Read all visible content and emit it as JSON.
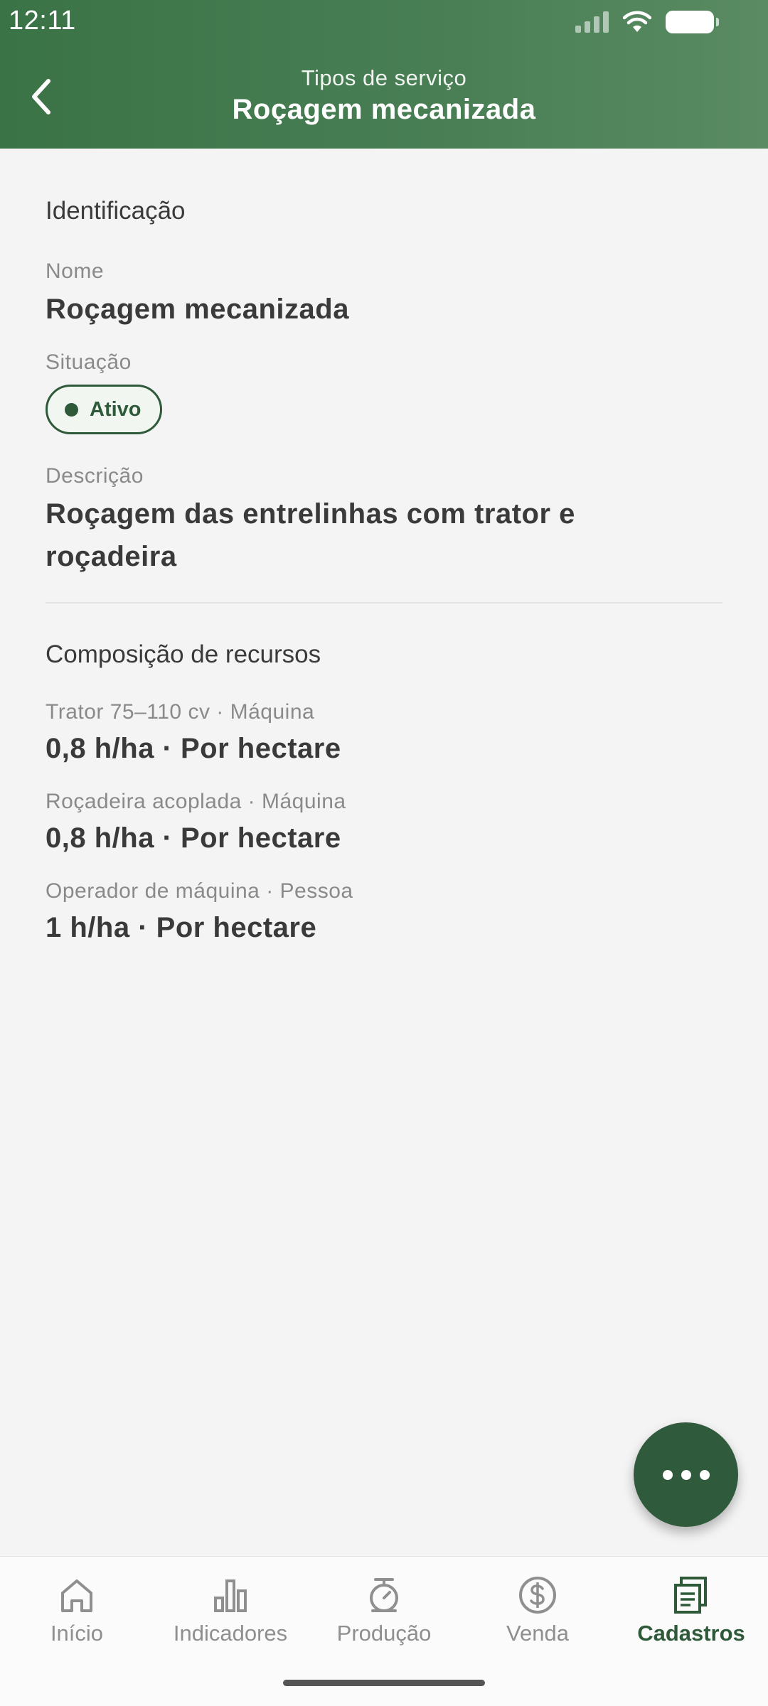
{
  "status_bar": {
    "time": "12:11"
  },
  "header": {
    "subtitle": "Tipos de serviço",
    "title": "Roçagem mecanizada"
  },
  "identification": {
    "section_title": "Identificação",
    "name_label": "Nome",
    "name_value": "Roçagem mecanizada",
    "status_label": "Situação",
    "status_value": "Ativo",
    "description_label": "Descrição",
    "description_line1": "Roçagem das entrelinhas com trator e",
    "description_line2": "roçadeira"
  },
  "resources": {
    "section_title": "Composição de recursos",
    "items": [
      {
        "label": "Trator 75–110 cv · Máquina",
        "value": "0,8 h/ha · Por hectare"
      },
      {
        "label": "Roçadeira acoplada · Máquina",
        "value": "0,8 h/ha · Por hectare"
      },
      {
        "label": "Operador de máquina · Pessoa",
        "value": "1 h/ha · Por hectare"
      }
    ]
  },
  "fab": {
    "icon": "more-horizontal-icon"
  },
  "bottom_nav": {
    "items": [
      {
        "label": "Início",
        "icon": "home-icon",
        "active": false
      },
      {
        "label": "Indicadores",
        "icon": "bar-chart-icon",
        "active": false
      },
      {
        "label": "Produção",
        "icon": "scale-icon",
        "active": false
      },
      {
        "label": "Venda",
        "icon": "dollar-icon",
        "active": false
      },
      {
        "label": "Cadastros",
        "icon": "registry-icon",
        "active": true
      }
    ]
  },
  "colors": {
    "header_green": "#3a7346",
    "accent_dark_green": "#2e5a3a",
    "background": "#f4f4f4",
    "nav_inactive": "#8f8f8f"
  }
}
